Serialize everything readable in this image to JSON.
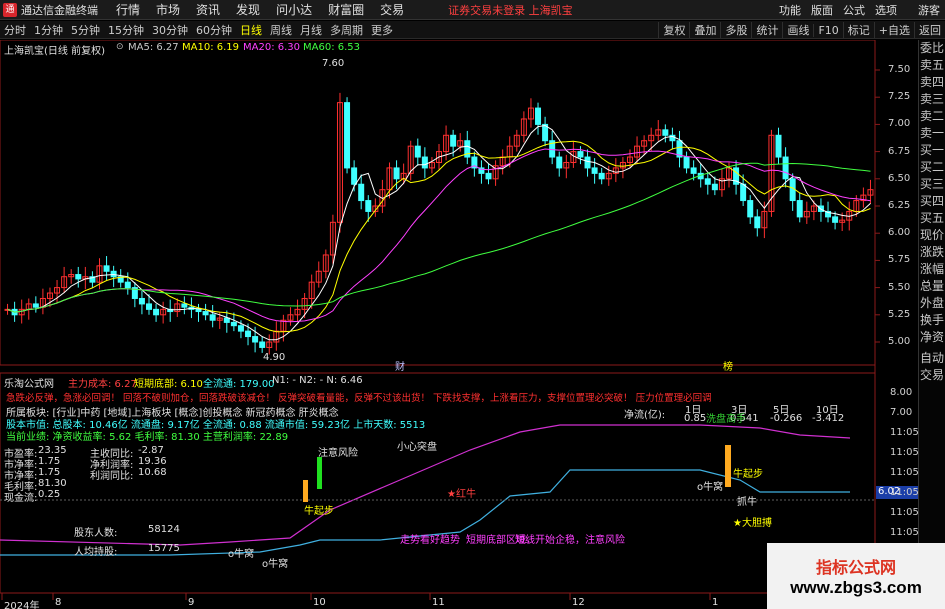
{
  "menubar": {
    "app_title": "通达信金融终端",
    "items": [
      "行情",
      "市场",
      "资讯",
      "发现",
      "问小达",
      "财富圈",
      "交易"
    ],
    "warning": "证券交易未登录  上海凯宝",
    "right_items": [
      "功能",
      "版面",
      "公式",
      "选项",
      "游客"
    ]
  },
  "toolbar": {
    "periods": [
      "分时",
      "1分钟",
      "5分钟",
      "15分钟",
      "30分钟",
      "60分钟",
      "日线",
      "周线",
      "月线",
      "多周期",
      "更多"
    ],
    "active_period": "日线",
    "right_buttons": [
      "复权",
      "叠加",
      "多股",
      "统计",
      "画线",
      "F10",
      "标记",
      "+自选",
      "返回"
    ]
  },
  "price_panel": {
    "title": "上海凯宝(日线 前复权)",
    "ma_labels": [
      {
        "text": "MA5: 6.27",
        "color": "#ffffff"
      },
      {
        "text": "MA10: 6.19",
        "color": "#ffff00"
      },
      {
        "text": "MA20: 6.30",
        "color": "#ff40ff"
      },
      {
        "text": "MA60: 6.53",
        "color": "#40ff40"
      }
    ],
    "y_ticks": [
      "7.50",
      "7.25",
      "7.00",
      "6.75",
      "6.50",
      "6.25",
      "6.00",
      "5.75",
      "5.50",
      "5.25",
      "5.00"
    ],
    "high_marker": "7.60",
    "low_marker": "4.90",
    "event_markers": [
      "财",
      "榜"
    ]
  },
  "indicator_panel": {
    "title": "乐淘公式网",
    "header_items": [
      {
        "text": "主力成本: 6.27",
        "color": "#ff4040"
      },
      {
        "text": "短期底部: 6.10",
        "color": "#ffff00"
      },
      {
        "text": "全流通: 179.00",
        "color": "#40ffff"
      },
      {
        "text": "N1: -  N2: -  N: 6.46",
        "color": "#ffffff"
      }
    ],
    "red_line": "急跌必反弹，急涨必回调！ 回落不破则加仓，回落跌破该减仓！ 反弹突破看量能，反弹不过该出货！ 下跌找支撑，上涨看压力，支撑位置理必突破！ 压力位置理必回调",
    "info_lines": [
      {
        "text": "所属板块: [行业]中药 [地域]上海板块 [概念]创投概念 新冠药概念 肝炎概念",
        "color": "#ffffff"
      },
      {
        "text": "股本市值: 总股本: 10.46亿 流通盘: 9.17亿 全流通: 0.88 流通市值: 59.23亿 上市天数: 5513",
        "color": "#40ffff"
      },
      {
        "text": "当前业绩: 净资收益率: 5.62 毛利率: 81.30 主营利润率: 22.89",
        "color": "#40ff40"
      }
    ],
    "net_flow": {
      "label": "净流(亿):",
      "headers": [
        "1日",
        "3日",
        "5日",
        "10日"
      ],
      "values": [
        "0.85",
        "0.541",
        "-0.266",
        "-3.412"
      ]
    },
    "left_stats": [
      [
        "市盈率:",
        "23.35"
      ],
      [
        "市净率:",
        "1.75"
      ],
      [
        "市净率:",
        "1.75"
      ],
      [
        "毛利率:",
        "81.30"
      ],
      [
        "现金流:",
        "0.25"
      ]
    ],
    "mid_stats": [
      [
        "主收同比:",
        "-2.87"
      ],
      [
        "净利润率:",
        "19.36"
      ],
      [
        "利润同比:",
        "10.68"
      ]
    ],
    "shareholders": {
      "label": "股东人数:",
      "value": "58124"
    },
    "per_capita": {
      "label": "人均持股:",
      "value": "15775"
    },
    "annotations": {
      "caution_top": "小心突盘",
      "risk_label": "注意风险",
      "start_label": "牛起步",
      "red_bull": "★红牛",
      "start_label2": "牛起步",
      "bull_nest1": "o牛窝",
      "bull_nest2": "o牛窝",
      "bull_nest3": "o牛窝",
      "catch_bull": "抓牛",
      "big_bold": "★大胆搏",
      "purple_1": "走势看好趋势",
      "purple_2": "短期底部区域，",
      "purple_3": "短线开始企稳，注意风险",
      "wash_label": "洗盘高手",
      "right_value": "6.02"
    },
    "y_ticks": [
      "8.00",
      "7.00",
      "11:05",
      "11:05",
      "11:05",
      "11:05",
      "11:05",
      "11:05",
      "11:05"
    ]
  },
  "x_axis": {
    "labels": [
      "2024年",
      "8",
      "9",
      "10",
      "11",
      "12",
      "1"
    ]
  },
  "side_panel": {
    "items": [
      "委比",
      "卖五",
      "卖四",
      "卖三",
      "卖二",
      "卖一",
      "买一",
      "买二",
      "买三",
      "买四",
      "买五",
      "现价",
      "涨跌",
      "涨幅",
      "总量",
      "外盘",
      "换手",
      "净资",
      "自动",
      "交易"
    ]
  },
  "watermark": {
    "line1": "指标公式网",
    "line2": "www.zbgs3.com"
  }
}
